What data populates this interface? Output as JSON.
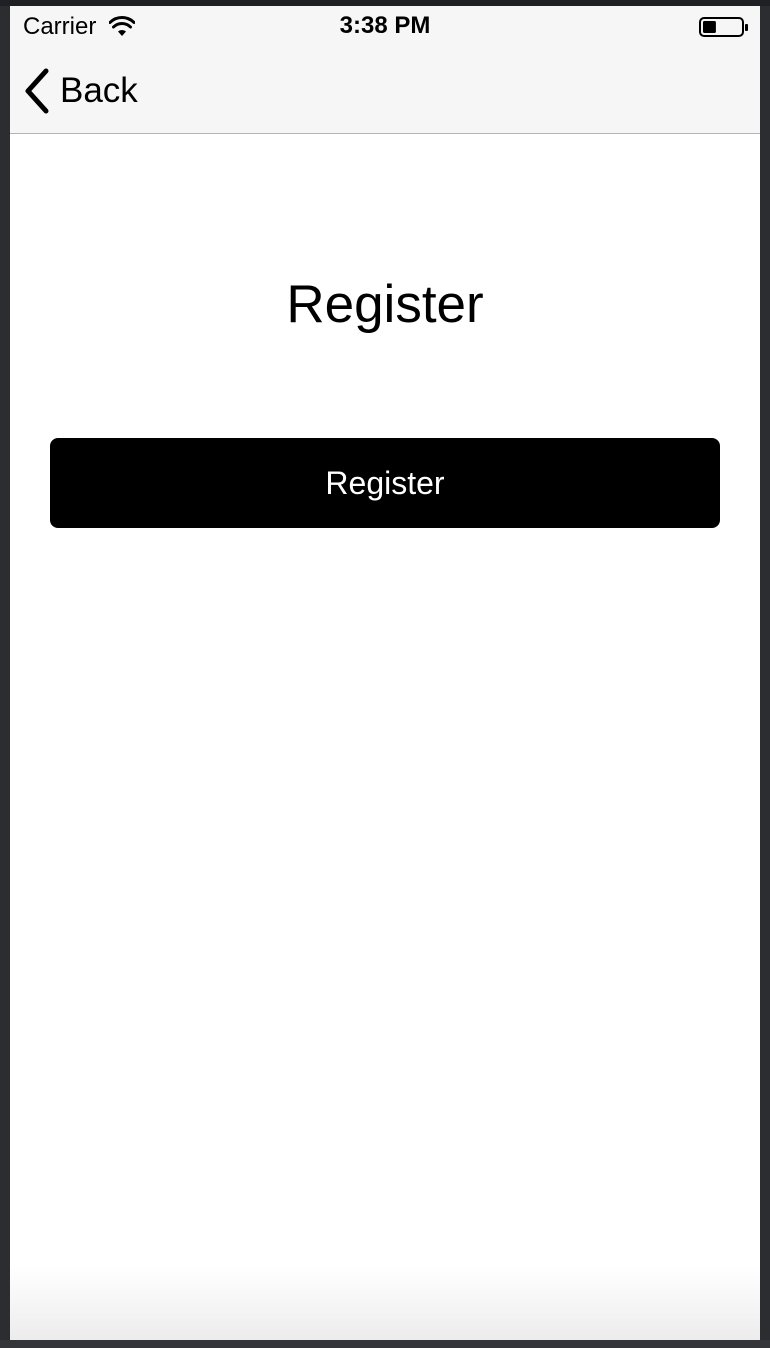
{
  "status_bar": {
    "carrier": "Carrier",
    "time": "3:38 PM",
    "wifi_icon": "wifi-icon",
    "battery_icon": "battery-icon",
    "battery_level": 0.35
  },
  "nav_bar": {
    "back_label": "Back",
    "back_icon": "chevron-left-icon"
  },
  "main": {
    "title": "Register",
    "register_button_label": "Register"
  },
  "colors": {
    "bar_background": "#f6f6f6",
    "button_background": "#000000",
    "button_text": "#ffffff"
  }
}
